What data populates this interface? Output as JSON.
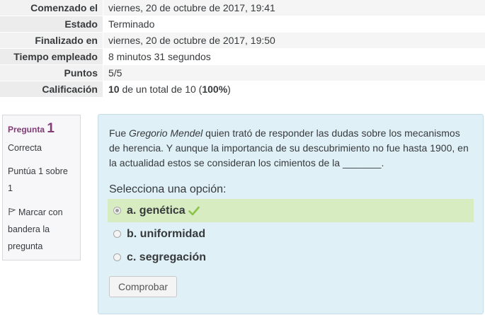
{
  "summary": [
    {
      "label": "Comenzado el",
      "value": "viernes, 20 de octubre de 2017, 19:41"
    },
    {
      "label": "Estado",
      "value": "Terminado"
    },
    {
      "label": "Finalizado en",
      "value": "viernes, 20 de octubre de 2017, 19:50"
    },
    {
      "label": "Tiempo empleado",
      "value": "8 minutos 31 segundos"
    },
    {
      "label": "Puntos",
      "value": "5/5"
    },
    {
      "label": "Calificación",
      "grade_value": "10",
      "grade_mid": " de un total de 10 (",
      "grade_pct": "100%",
      "grade_end": ")"
    }
  ],
  "question_info": {
    "label": "Pregunta",
    "number": "1",
    "state": "Correcta",
    "grade": "Puntúa 1 sobre 1",
    "flag_label": "Marcar con bandera la pregunta"
  },
  "question": {
    "text_pre": "Fue ",
    "text_name": "Gregorio Mendel",
    "text_post": " quien trató de responder las dudas sobre los mecanismos de herencia. Y aunque la importancia de su descubrimiento no fue hasta 1900, en la actualidad estos se consideran los cimientos de la _______.",
    "prompt": "Selecciona una opción:",
    "options": [
      {
        "label": "a. genética",
        "selected": true,
        "correct": true
      },
      {
        "label": "b. uniformidad",
        "selected": false,
        "correct": false
      },
      {
        "label": "c. segregación",
        "selected": false,
        "correct": false
      }
    ],
    "submit_label": "Comprobar"
  },
  "colors": {
    "accent": "#813c77",
    "correct_bg": "#d7ecc1",
    "content_bg": "#dff0f7",
    "check": "#8bc34a"
  },
  "icons": {
    "flag": "flag-icon",
    "check": "check-icon"
  }
}
